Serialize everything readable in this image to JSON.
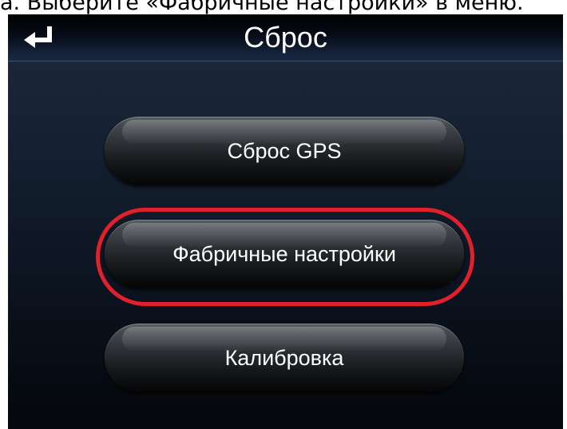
{
  "caption": "a. Выберите «Фабричные настройки» в меню.",
  "header": {
    "title": "Сброс",
    "back_icon": "return-arrow-icon"
  },
  "menu": {
    "items": [
      {
        "label": "Сброс GPS"
      },
      {
        "label": "Фабричные настройки",
        "highlighted": true
      },
      {
        "label": "Калибровка"
      }
    ]
  },
  "colors": {
    "highlight": "#e0202a",
    "title_bar": "#000000",
    "text": "#ffffff"
  }
}
